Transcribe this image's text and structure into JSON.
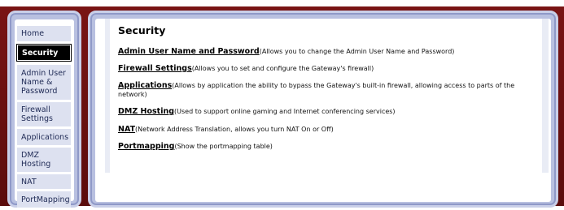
{
  "sidebar": {
    "items": [
      {
        "label": "Home"
      },
      {
        "label": "Security",
        "active": true
      },
      {
        "label": "Admin User Name & Password"
      },
      {
        "label": "Firewall Settings"
      },
      {
        "label": "Applications"
      },
      {
        "label": "DMZ Hosting"
      },
      {
        "label": "NAT"
      },
      {
        "label": "PortMapping"
      }
    ]
  },
  "main": {
    "title": "Security",
    "entries": [
      {
        "link": "Admin User Name and Password",
        "description": "(Allows you to change the Admin User Name and Password)"
      },
      {
        "link": "Firewall Settings",
        "description": "(Allows you to set and configure the Gateway's firewall)"
      },
      {
        "link": "Applications",
        "description": "(Allows by application the ability to bypass the Gateway's built-in firewall, allowing access to parts of the network)"
      },
      {
        "link": "DMZ Hosting",
        "description": "(Used to support online gaming and Internet conferencing services)"
      },
      {
        "link": "NAT",
        "description": "(Network Address Translation, allows you turn NAT On or Off)"
      },
      {
        "link": "Portmapping",
        "description": "(Show the portmapping table)"
      }
    ]
  },
  "colors": {
    "background": "#6e1010",
    "panel_frame": "#b8c0e0",
    "nav_item_bg": "#dde1f0",
    "nav_active_bg": "#000000"
  }
}
